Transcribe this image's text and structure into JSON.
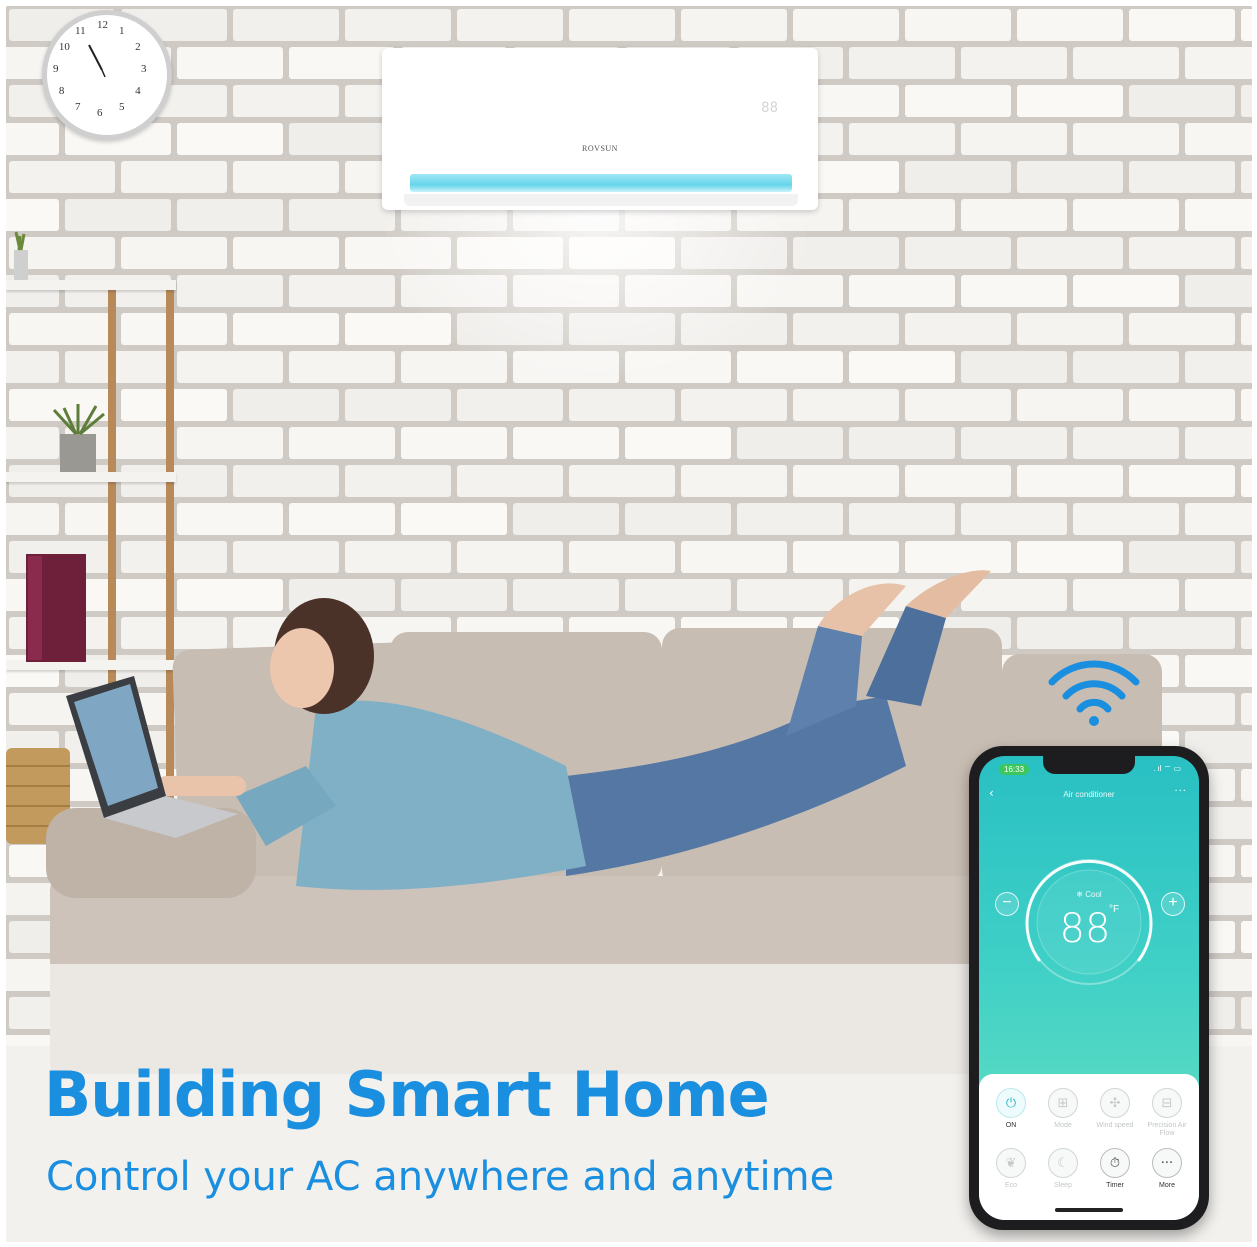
{
  "ac_unit": {
    "brand": "ROVSUN",
    "display": "88"
  },
  "clock": {
    "numerals": [
      "12",
      "1",
      "2",
      "3",
      "4",
      "5",
      "6",
      "7",
      "8",
      "9",
      "10",
      "11"
    ]
  },
  "phone": {
    "status_time": "16:33",
    "status_icons": " . ıl ⌔ ▭",
    "app_title": "Air conditioner",
    "back_icon": "‹",
    "more_icon": "···",
    "mode_label": "❄ Cool",
    "temperature": "88",
    "temperature_unit": "°F",
    "minus_label": "−",
    "plus_label": "+",
    "controls": [
      {
        "icon": "power-icon",
        "glyph": "⏻",
        "label": "ON",
        "active": true
      },
      {
        "icon": "mode-icon",
        "glyph": "⊞",
        "label": "Mode",
        "active": false
      },
      {
        "icon": "fan-icon",
        "glyph": "✣",
        "label": "Wind speed",
        "active": false
      },
      {
        "icon": "airflow-icon",
        "glyph": "⊟",
        "label": "Precision Air Flow",
        "active": false
      },
      {
        "icon": "eco-icon",
        "glyph": "❦",
        "label": "Eco",
        "active": false
      },
      {
        "icon": "sleep-icon",
        "glyph": "☾",
        "label": "Sleep",
        "active": false
      },
      {
        "icon": "timer-icon",
        "glyph": "⏱",
        "label": "Timer",
        "active": true
      },
      {
        "icon": "more-icon",
        "glyph": "···",
        "label": "More",
        "active": true
      }
    ]
  },
  "headline": "Building Smart Home",
  "subline": "Control your AC anywhere and anytime",
  "colors": {
    "headline": "#1a8fe0",
    "app_gradient_top": "#29c0c4",
    "app_gradient_bottom": "#6ee2c2",
    "wifi": "#1a8fe0"
  }
}
